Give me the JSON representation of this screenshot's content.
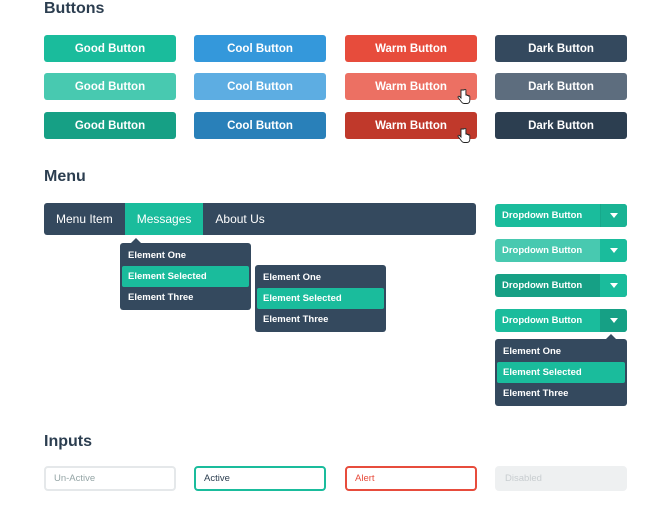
{
  "sections": {
    "buttons": "Buttons",
    "menu": "Menu",
    "inputs": "Inputs"
  },
  "colors": {
    "good": [
      "#1abc9c",
      "#48c9b0",
      "#16a085"
    ],
    "cool": [
      "#3498db",
      "#5dade2",
      "#2980b9"
    ],
    "warm": [
      "#e74c3c",
      "#ec7063",
      "#c0392b"
    ],
    "dark": [
      "#34495e",
      "#5d6d7e",
      "#2c3e50"
    ],
    "menu_bg": "#34495e",
    "accent": "#1abc9c"
  },
  "buttons": {
    "good": "Good Button",
    "cool": "Cool Button",
    "warm": "Warm Button",
    "dark": "Dark Button",
    "states": [
      "normal",
      "hover",
      "pressed"
    ]
  },
  "menu": {
    "items": [
      {
        "label": "Menu Item",
        "active": false
      },
      {
        "label": "Messages",
        "active": true
      },
      {
        "label": "About Us",
        "active": false
      }
    ],
    "dropdown_a": [
      "Element One",
      "Element Selected",
      "Element Three"
    ],
    "dropdown_b": [
      "Element One",
      "Element Selected",
      "Element Three"
    ],
    "selected_index": 1
  },
  "dropdown_buttons": {
    "label": "Dropdown Button",
    "toggle_icon": "caret-down-icon",
    "menu": [
      "Element One",
      "Element Selected",
      "Element Three"
    ]
  },
  "inputs": {
    "unactive": {
      "placeholder": "Un-Active"
    },
    "active": {
      "value": "Active"
    },
    "alert": {
      "value": "Alert"
    },
    "disabled": {
      "placeholder": "Disabled"
    }
  }
}
